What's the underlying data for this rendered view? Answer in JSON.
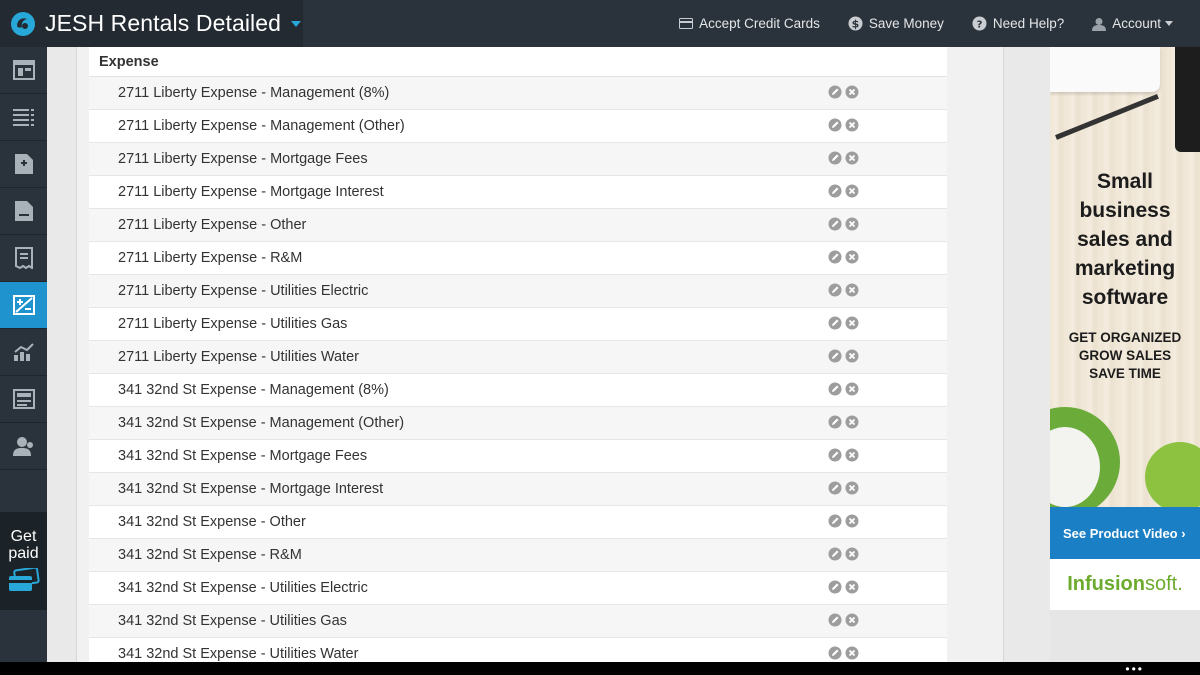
{
  "app": {
    "title": "JESH Rentals Detailed"
  },
  "topnav": {
    "items": [
      {
        "label": "Accept Credit Cards",
        "icon": "credit-card-icon"
      },
      {
        "label": "Save Money",
        "icon": "dollar-icon"
      },
      {
        "label": "Need Help?",
        "icon": "help-icon"
      },
      {
        "label": "Account",
        "icon": "user-icon"
      }
    ]
  },
  "sidebar": {
    "items": [
      {
        "icon": "dashboard-icon"
      },
      {
        "icon": "list-icon"
      },
      {
        "icon": "invoice-add-icon"
      },
      {
        "icon": "document-icon"
      },
      {
        "icon": "receipt-icon"
      },
      {
        "icon": "accounting-icon",
        "active": true
      },
      {
        "icon": "reports-chart-icon"
      },
      {
        "icon": "card-list-icon"
      },
      {
        "icon": "users-icon"
      }
    ],
    "get_paid": "Get\npaid"
  },
  "section": {
    "header": "Expense",
    "rows": [
      "2711 Liberty Expense - Management (8%)",
      "2711 Liberty Expense - Management (Other)",
      "2711 Liberty Expense - Mortgage Fees",
      "2711 Liberty Expense - Mortgage Interest",
      "2711 Liberty Expense - Other",
      "2711 Liberty Expense - R&M",
      "2711 Liberty Expense - Utilities Electric",
      "2711 Liberty Expense - Utilities Gas",
      "2711 Liberty Expense - Utilities Water",
      "341 32nd St Expense - Management (8%)",
      "341 32nd St Expense - Management (Other)",
      "341 32nd St Expense - Mortgage Fees",
      "341 32nd St Expense - Mortgage Interest",
      "341 32nd St Expense - Other",
      "341 32nd St Expense - R&M",
      "341 32nd St Expense - Utilities Electric",
      "341 32nd St Expense - Utilities Gas",
      "341 32nd St Expense - Utilities Water"
    ]
  },
  "ad": {
    "headline": [
      "Small",
      "business",
      "sales and",
      "marketing",
      "software"
    ],
    "sub": [
      "GET ORGANIZED",
      "GROW SALES",
      "SAVE TIME"
    ],
    "video_label": "See Product Video ›",
    "brand_a": "Infusion",
    "brand_b": "soft."
  },
  "colors": {
    "topbar": "#2a333b",
    "accent": "#1f93cd",
    "ad_blue": "#1b7fc6",
    "ad_green": "#6cab2e"
  }
}
